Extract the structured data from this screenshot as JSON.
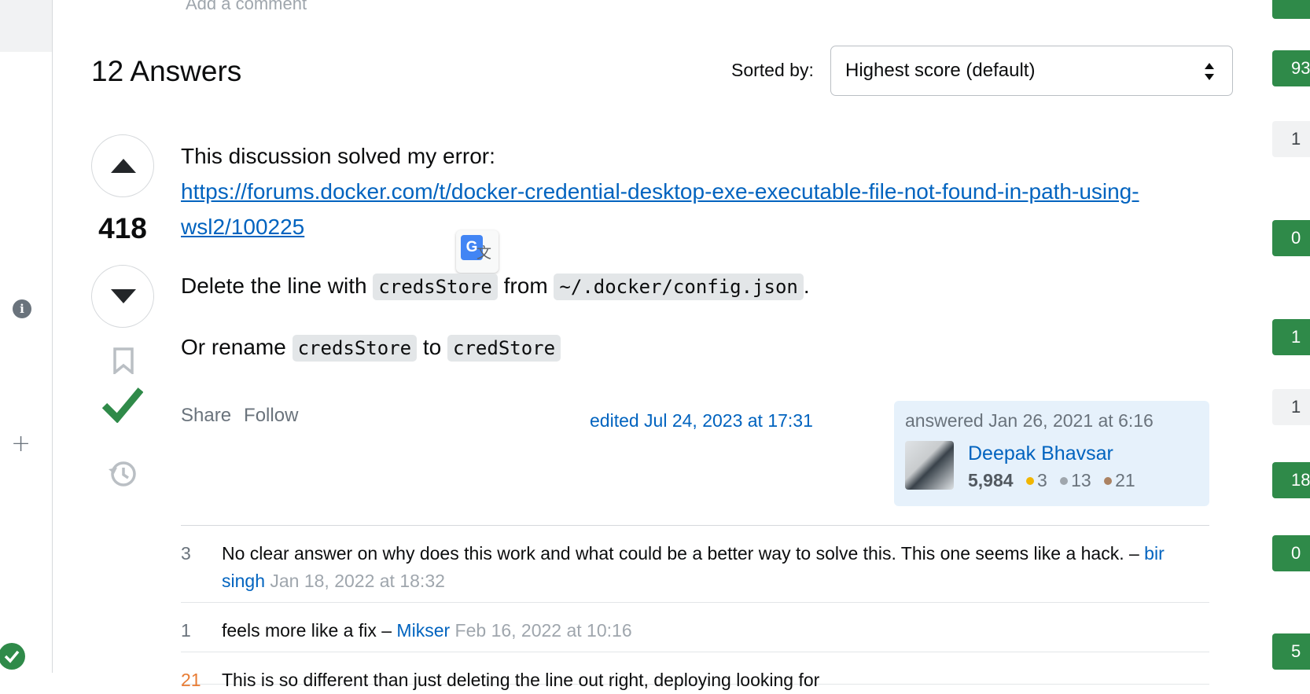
{
  "top": {
    "add_comment": "Add a comment"
  },
  "answers": {
    "heading": "12 Answers",
    "sort_label": "Sorted by:",
    "sort_value": "Highest score (default)"
  },
  "answer": {
    "score": "418",
    "line1": "This discussion solved my error:",
    "link": "https://forums.docker.com/t/docker-credential-desktop-exe-executable-file-not-found-in-path-using-wsl2/100225",
    "line2_pre": "Delete the line with",
    "code1": "credsStore",
    "line2_mid": "from",
    "code2": "~/.docker/config.json",
    "line2_post": ".",
    "line3_pre": "Or rename",
    "code3": "credsStore",
    "line3_mid": "to",
    "code4": "credStore",
    "share": "Share",
    "follow": "Follow",
    "edited": "edited Jul 24, 2023 at 17:31",
    "answered": "answered Jan 26, 2021 at 6:16",
    "user_name": "Deepak Bhavsar",
    "reputation": "5,984",
    "gold": "3",
    "silver": "13",
    "bronze": "21"
  },
  "comments": [
    {
      "score": "3",
      "text": "No clear answer on why does this work and what could be a better way to solve this. This one seems like a hack. –",
      "user": "bir singh",
      "date": "Jan 18, 2022 at 18:32"
    },
    {
      "score": "1",
      "text": "feels more like a fix –",
      "user": "Mikser",
      "date": "Feb 16, 2022 at 10:16"
    },
    {
      "score": "21",
      "text": "This is so different than just deleting the line out right, deploying looking for",
      "user": "",
      "date": ""
    }
  ],
  "side_badges": [
    "93",
    "1",
    "0",
    "1",
    "1",
    "18",
    "0",
    "5"
  ],
  "colors": {
    "accent": "#0063bf",
    "accepted": "#2f8a49",
    "card": "#e6f1fb"
  }
}
